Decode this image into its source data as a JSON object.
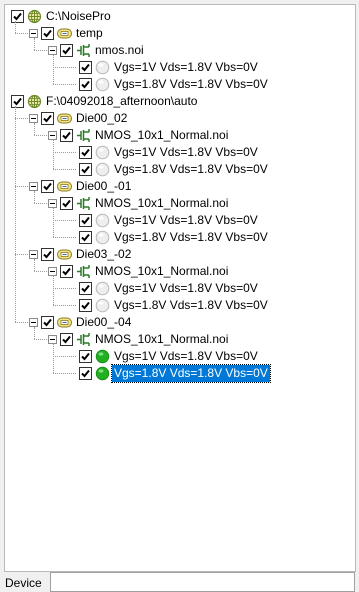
{
  "tree": {
    "roots": [
      {
        "label": "C:\\NoisePro",
        "icon": "globe-icon",
        "children": [
          {
            "label": "temp",
            "icon": "device-icon",
            "children": [
              {
                "label": "nmos.noi",
                "icon": "transistor-icon",
                "children": [
                  {
                    "label": "Vgs=1V Vds=1.8V Vbs=0V",
                    "icon": "status-circle-gray-icon"
                  },
                  {
                    "label": "Vgs=1.8V Vds=1.8V Vbs=0V",
                    "icon": "status-circle-gray-icon"
                  }
                ]
              }
            ]
          }
        ]
      },
      {
        "label": "F:\\04092018_afternoon\\auto",
        "icon": "globe-icon",
        "children": [
          {
            "label": "Die00_02",
            "icon": "device-icon",
            "children": [
              {
                "label": "NMOS_10x1_Normal.noi",
                "icon": "transistor-icon",
                "children": [
                  {
                    "label": "Vgs=1V Vds=1.8V Vbs=0V",
                    "icon": "status-circle-gray-icon"
                  },
                  {
                    "label": "Vgs=1.8V Vds=1.8V Vbs=0V",
                    "icon": "status-circle-gray-icon"
                  }
                ]
              }
            ]
          },
          {
            "label": "Die00_-01",
            "icon": "device-icon",
            "children": [
              {
                "label": "NMOS_10x1_Normal.noi",
                "icon": "transistor-icon",
                "children": [
                  {
                    "label": "Vgs=1V Vds=1.8V Vbs=0V",
                    "icon": "status-circle-gray-icon"
                  },
                  {
                    "label": "Vgs=1.8V Vds=1.8V Vbs=0V",
                    "icon": "status-circle-gray-icon"
                  }
                ]
              }
            ]
          },
          {
            "label": "Die03_-02",
            "icon": "device-icon",
            "children": [
              {
                "label": "NMOS_10x1_Normal.noi",
                "icon": "transistor-icon",
                "children": [
                  {
                    "label": "Vgs=1V Vds=1.8V Vbs=0V",
                    "icon": "status-circle-gray-icon"
                  },
                  {
                    "label": "Vgs=1.8V Vds=1.8V Vbs=0V",
                    "icon": "status-circle-gray-icon"
                  }
                ]
              }
            ]
          },
          {
            "label": "Die00_-04",
            "icon": "device-icon",
            "children": [
              {
                "label": "NMOS_10x1_Normal.noi",
                "icon": "transistor-icon",
                "children": [
                  {
                    "label": "Vgs=1V Vds=1.8V Vbs=0V",
                    "icon": "status-circle-green-icon"
                  },
                  {
                    "label": "Vgs=1.8V Vds=1.8V Vbs=0V",
                    "icon": "status-circle-green-icon",
                    "selected": true
                  }
                ]
              }
            ]
          }
        ]
      }
    ]
  },
  "bottom": {
    "label": "Device",
    "value": ""
  },
  "colors": {
    "selection": "#0078d7",
    "status_green": "#22b022",
    "status_gray": "#d4d4d4",
    "check": "#000000"
  }
}
